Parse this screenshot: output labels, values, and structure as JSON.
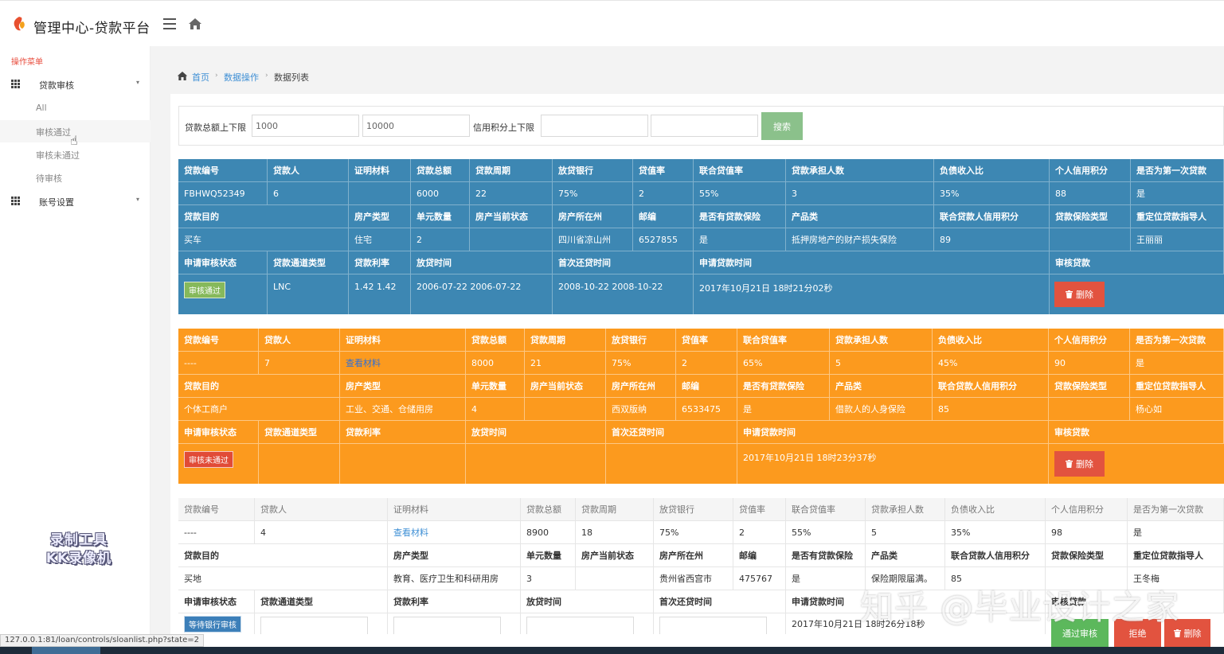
{
  "header": {
    "title": "管理中心-贷款平台"
  },
  "sidebar": {
    "caption": "操作菜单",
    "groups": [
      {
        "label": "贷款审核",
        "caret": "▾"
      },
      {
        "label": "账号设置",
        "caret": "▾"
      }
    ],
    "subitems": [
      {
        "label": "All"
      },
      {
        "label": "审核通过"
      },
      {
        "label": "审核未通过"
      },
      {
        "label": "待审核"
      }
    ]
  },
  "breadcrumb": {
    "home": "首页",
    "section": "数据操作",
    "current": "数据列表",
    "sep": "›"
  },
  "search": {
    "amount_label": "贷款总额上下限",
    "amount_min": "1000",
    "amount_max": "10000",
    "credit_label": "信用积分上下限",
    "credit_min": "",
    "credit_max": "",
    "button": "搜索"
  },
  "labels": {
    "loan_no": "贷款编号",
    "borrower": "贷款人",
    "proof": "证明材料",
    "total": "贷款总额",
    "period": "贷款周期",
    "bank": "放贷银行",
    "value_rate": "贷值率",
    "joint_value_rate": "联合贷值率",
    "joint_count": "贷款承担人数",
    "debt_ratio": "负债收入比",
    "credit": "个人信用积分",
    "first_loan": "是否为第一次贷款",
    "purpose": "贷款目的",
    "property_type": "房产类型",
    "units": "单元数量",
    "property_status": "房产当前状态",
    "location": "房产所在州",
    "zip": "邮编",
    "insured": "是否有贷款保险",
    "product": "产品类",
    "joint_credit": "联合贷款人信用积分",
    "insurance_type": "贷款保险类型",
    "relocation": "重定位贷款指导人",
    "status": "申请审核状态",
    "channel": "贷款通道类型",
    "interest": "贷款利率",
    "loan_time": "放贷时间",
    "first_repay": "首次还贷时间",
    "apply_time": "申请贷款时间",
    "review": "审核贷款"
  },
  "actions": {
    "delete": "删除",
    "approve": "通过审核",
    "reject": "拒绝",
    "view_proof": "查看材料"
  },
  "records": [
    {
      "loan_no": "FBHWQ52349",
      "borrower": "6",
      "proof": "",
      "total": "6000",
      "period": "22",
      "bank": "75%",
      "value_rate": "2",
      "joint_value_rate": "55%",
      "joint_count": "3",
      "debt_ratio": "35%",
      "credit": "88",
      "first_loan": "是",
      "purpose": "买车",
      "property_type": "住宅",
      "units": "2",
      "property_status": "",
      "location": "四川省凉山州",
      "zip": "6527855",
      "insured": "是",
      "product": "抵押房地产的财产损失保险",
      "joint_credit": "89",
      "insurance_type": "",
      "relocation": "王丽丽",
      "status": "审核通过",
      "channel": "LNC",
      "interest": "1.42 1.42",
      "loan_time": "2006-07-22 2006-07-22",
      "first_repay": "2008-10-22 2008-10-22",
      "apply_time": "2017年10月21日 18时21分02秒"
    },
    {
      "loan_no": "----",
      "borrower": "7",
      "proof": "查看材料",
      "total": "8000",
      "period": "21",
      "bank": "75%",
      "value_rate": "2",
      "joint_value_rate": "65%",
      "joint_count": "5",
      "debt_ratio": "45%",
      "credit": "90",
      "first_loan": "是",
      "purpose": "个体工商户",
      "property_type": "工业、交通、仓储用房",
      "units": "4",
      "property_status": "",
      "location": "西双版纳",
      "zip": "6533475",
      "insured": "是",
      "product": "借款人的人身保险",
      "joint_credit": "85",
      "insurance_type": "",
      "relocation": "杨心如",
      "status": "审核未通过",
      "channel": "",
      "interest": "",
      "loan_time": "",
      "first_repay": "",
      "apply_time": "2017年10月21日 18时23分37秒"
    },
    {
      "loan_no": "----",
      "borrower": "4",
      "proof": "查看材料",
      "total": "8900",
      "period": "18",
      "bank": "75%",
      "value_rate": "2",
      "joint_value_rate": "55%",
      "joint_count": "5",
      "debt_ratio": "35%",
      "credit": "98",
      "first_loan": "是",
      "purpose": "买地",
      "property_type": "教育、医疗卫生和科研用房",
      "units": "3",
      "property_status": "",
      "location": "贵州省西宫市",
      "zip": "475767",
      "insured": "是",
      "product": "保险期限届满。",
      "joint_credit": "85",
      "insurance_type": "",
      "relocation": "王冬梅",
      "status": "等待银行审核",
      "channel": "",
      "interest": "",
      "loan_time": "",
      "first_repay": "",
      "apply_time": "2017年10月21日 18时26分18秒"
    }
  ],
  "statusbar": {
    "url": "127.0.0.1:81/loan/controls/sloanlist.php?state=2"
  },
  "overlays": {
    "recorder_watermark_line1": "录制工具",
    "recorder_watermark_line2": "KK录像机",
    "zhihu_watermark": "知乎 @毕业设计之家"
  },
  "colors": {
    "approved_row": "#3d87b3",
    "rejected_row": "#fc9a1e",
    "accent_link": "#3e8fd5",
    "delete_button": "#e2533f",
    "approve_button": "#5cb85c",
    "search_button": "#8bc18b",
    "menu_caption": "#e84c3d"
  },
  "icons": {
    "logo": "logo-flame-icon",
    "hamburger": "hamburger-icon",
    "home": "home-icon",
    "grid": "grid-icon",
    "trash": "trash-icon",
    "cursor": "hand-cursor-icon"
  }
}
